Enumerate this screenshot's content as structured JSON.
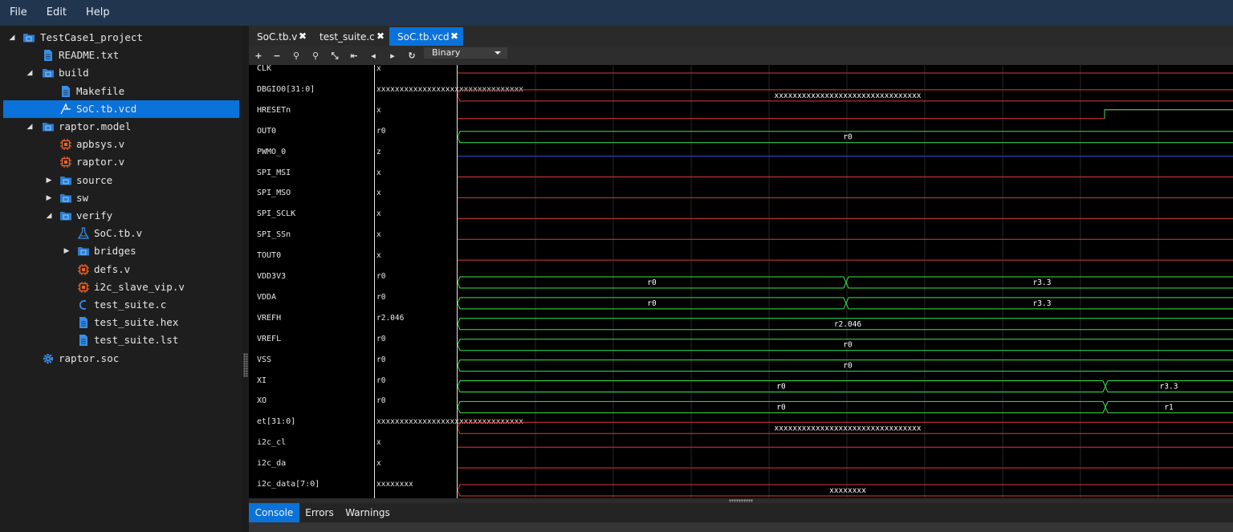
{
  "menu": [
    "File",
    "Edit",
    "Help"
  ],
  "tree": [
    {
      "label": "TestCase1_project",
      "icon": "folder-icon",
      "arrow": "expanded"
    },
    {
      "label": "README.txt",
      "icon": "file-icon"
    },
    {
      "label": "build",
      "icon": "folder-icon",
      "arrow": "expanded"
    },
    {
      "label": "Makefile",
      "icon": "file-icon"
    },
    {
      "label": "SoC.tb.vcd",
      "icon": "waveform-icon",
      "selected": true
    },
    {
      "label": "raptor.model",
      "icon": "folder-icon",
      "arrow": "expanded"
    },
    {
      "label": "apbsys.v",
      "icon": "chip-icon"
    },
    {
      "label": "raptor.v",
      "icon": "chip-icon"
    },
    {
      "label": "source",
      "icon": "folder-icon",
      "arrow": "collapsed"
    },
    {
      "label": "sw",
      "icon": "folder-icon",
      "arrow": "collapsed"
    },
    {
      "label": "verify",
      "icon": "folder-icon",
      "arrow": "expanded"
    },
    {
      "label": "SoC.tb.v",
      "icon": "flask-icon"
    },
    {
      "label": "bridges",
      "icon": "folder-icon",
      "arrow": "collapsed"
    },
    {
      "label": "defs.v",
      "icon": "chip-icon"
    },
    {
      "label": "i2c_slave_vip.v",
      "icon": "chip-icon"
    },
    {
      "label": "test_suite.c",
      "icon": "c-icon"
    },
    {
      "label": "test_suite.hex",
      "icon": "file-icon"
    },
    {
      "label": "test_suite.lst",
      "icon": "file-icon"
    },
    {
      "label": "raptor.soc",
      "icon": "gear-icon"
    }
  ],
  "tabs": [
    {
      "label": "SoC.tb.v",
      "active": false
    },
    {
      "label": "test_suite.c",
      "active": false
    },
    {
      "label": "SoC.tb.vcd",
      "active": true
    }
  ],
  "toolbar": {
    "tools": [
      "zoom-in-icon",
      "zoom-out-icon",
      "zoom-fit-icon",
      "zoom-area-icon",
      "fullscreen-icon",
      "goto-start-icon",
      "prev-icon",
      "next-icon",
      "refresh-icon"
    ],
    "radix": "Binary"
  },
  "signals": [
    {
      "name": "CLK",
      "value": "x"
    },
    {
      "name": "DBGIO0[31:0]",
      "value": "xxxxxxxxxxxxxxxxxxxxxxxxxxxxxxxx"
    },
    {
      "name": "HRESETn",
      "value": "x"
    },
    {
      "name": "OUT0",
      "value": "r0"
    },
    {
      "name": "PWMO_0",
      "value": "z"
    },
    {
      "name": "SPI_MSI",
      "value": "x"
    },
    {
      "name": "SPI_MSO",
      "value": "x"
    },
    {
      "name": "SPI_SCLK",
      "value": "x"
    },
    {
      "name": "SPI_SSn",
      "value": "x"
    },
    {
      "name": "TOUT0",
      "value": "x"
    },
    {
      "name": "VDD3V3",
      "value": "r0"
    },
    {
      "name": "VDDA",
      "value": "r0"
    },
    {
      "name": "VREFH",
      "value": "r2.046"
    },
    {
      "name": "VREFL",
      "value": "r0"
    },
    {
      "name": "VSS",
      "value": "r0"
    },
    {
      "name": "XI",
      "value": "r0"
    },
    {
      "name": "XO",
      "value": "r0"
    },
    {
      "name": "et[31:0]",
      "value": "xxxxxxxxxxxxxxxxxxxxxxxxxxxxxxxx"
    },
    {
      "name": "i2c_cl",
      "value": "x"
    },
    {
      "name": "i2c_da",
      "value": "x"
    },
    {
      "name": "i2c_data[7:0]",
      "value": "xxxxxxxx"
    }
  ],
  "wave_labels": {
    "dbgio_seg2": "xxxxxxxxxxxxxxxxxxxxxxxxxxxxxxxx",
    "out0": "r0",
    "vdd3v3_a": "r0",
    "vdd3v3_b": "r3.3",
    "vdda_a": "r0",
    "vdda_b": "r3.3",
    "vrefh": "r2.046",
    "vrefl": "r0",
    "vss": "r0",
    "xi_a": "r0",
    "xi_b": "r3.3",
    "xo_a": "r0",
    "xo_b": "r1",
    "et_seg2": "xxxxxxxxxxxxxxxxxxxxxxxxxxxxxxxx",
    "i2c_data": "xxxxxxxx"
  },
  "colors": {
    "accent": "#0a72d9",
    "menubar": "#21354f",
    "wave_x": "#e0383e",
    "wave_analog": "#38e64a",
    "wave_z": "#2456e8"
  },
  "bottom_tabs": [
    {
      "label": "Console",
      "active": true
    },
    {
      "label": "Errors",
      "active": false
    },
    {
      "label": "Warnings",
      "active": false
    }
  ]
}
